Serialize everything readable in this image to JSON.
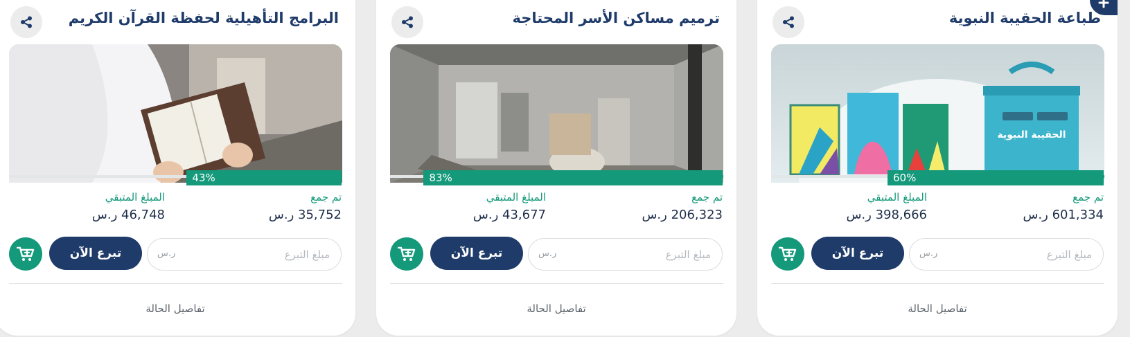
{
  "cards": [
    {
      "title": "طباعة الحقيبة النبوية",
      "progress_percent": 60,
      "progress_label": "60%",
      "collected_label": "تم جمع",
      "collected_value": "601,334",
      "remaining_label": "المبلغ المتبقي",
      "remaining_value": "398,666",
      "currency": "ر.س",
      "amount_placeholder": "مبلغ التبرع",
      "amount_currency": "ر.س",
      "donate_label": "تبرع الآن",
      "details_label": "تفاصيل الحالة",
      "photo_text": "الحقيبة النبوية"
    },
    {
      "title": "ترميم مساكن الأسر المحتاجة",
      "progress_percent": 83,
      "progress_label": "83%",
      "collected_label": "تم جمع",
      "collected_value": "206,323",
      "remaining_label": "المبلغ المتبقي",
      "remaining_value": "43,677",
      "currency": "ر.س",
      "amount_placeholder": "مبلغ التبرع",
      "amount_currency": "ر.س",
      "donate_label": "تبرع الآن",
      "details_label": "تفاصيل الحالة"
    },
    {
      "title": "البرامج التأهيلية لحفظة القرآن الكريم",
      "progress_percent": 43,
      "progress_label": "43%",
      "collected_label": "تم جمع",
      "collected_value": "35,752",
      "remaining_label": "المبلغ المتبقي",
      "remaining_value": "46,748",
      "currency": "ر.س",
      "amount_placeholder": "مبلغ التبرع",
      "amount_currency": "ر.س",
      "donate_label": "تبرع الآن",
      "details_label": "تفاصيل الحالة"
    }
  ],
  "colors": {
    "primary_navy": "#1f3b6a",
    "accent_green": "#14997a",
    "page_background": "#ececec"
  },
  "icons": {
    "share": "share-icon",
    "cart": "cart-plus-icon",
    "corner": "plus-icon"
  }
}
